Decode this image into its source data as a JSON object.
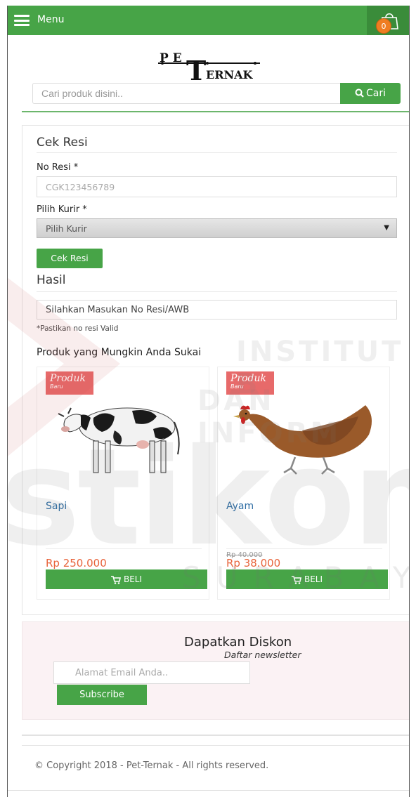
{
  "topbar": {
    "menu_label": "Menu",
    "cart_count": "0",
    "brand_color": "#47a447"
  },
  "logo": {
    "part1": "P E",
    "part2": "T",
    "part3": "ERNAK"
  },
  "search": {
    "placeholder": "Cari produk disini..",
    "button_label": "Cari"
  },
  "cek_resi": {
    "title": "Cek Resi",
    "no_resi_label": "No Resi *",
    "no_resi_placeholder": "CGK123456789",
    "kurir_label": "Pilih Kurir *",
    "kurir_selected": "Pilih Kurir",
    "button_label": "Cek Resi",
    "hasil_title": "Hasil",
    "hasil_value": "Silahkan Masukan No Resi/AWB",
    "note": "*Pastikan no resi Valid"
  },
  "products": {
    "title": "Produk yang Mungkin Anda Sukai",
    "items": [
      {
        "badge": "Produk",
        "badge_sub": "Baru",
        "name": "Sapi",
        "old_price": "",
        "price": "Rp 250.000",
        "buy_label": "BELI",
        "image": "cow-image"
      },
      {
        "badge": "Produk",
        "badge_sub": "Baru",
        "name": "Ayam",
        "old_price": "Rp 40.000",
        "price": "Rp 38.000",
        "buy_label": "BELI",
        "image": "chicken-image"
      }
    ]
  },
  "newsletter": {
    "title": "Dapatkan Diskon",
    "subtitle": "Daftar newsletter",
    "placeholder": "Alamat Email Anda..",
    "button_label": "Subscribe"
  },
  "footer": {
    "copyright": "© Copyright 2018 - Pet-Ternak - All rights reserved."
  },
  "watermark": {
    "line1": "INSTITUT B",
    "line2": "DAN INFORM",
    "line3": "stikom",
    "line4": "SURABAYA"
  }
}
